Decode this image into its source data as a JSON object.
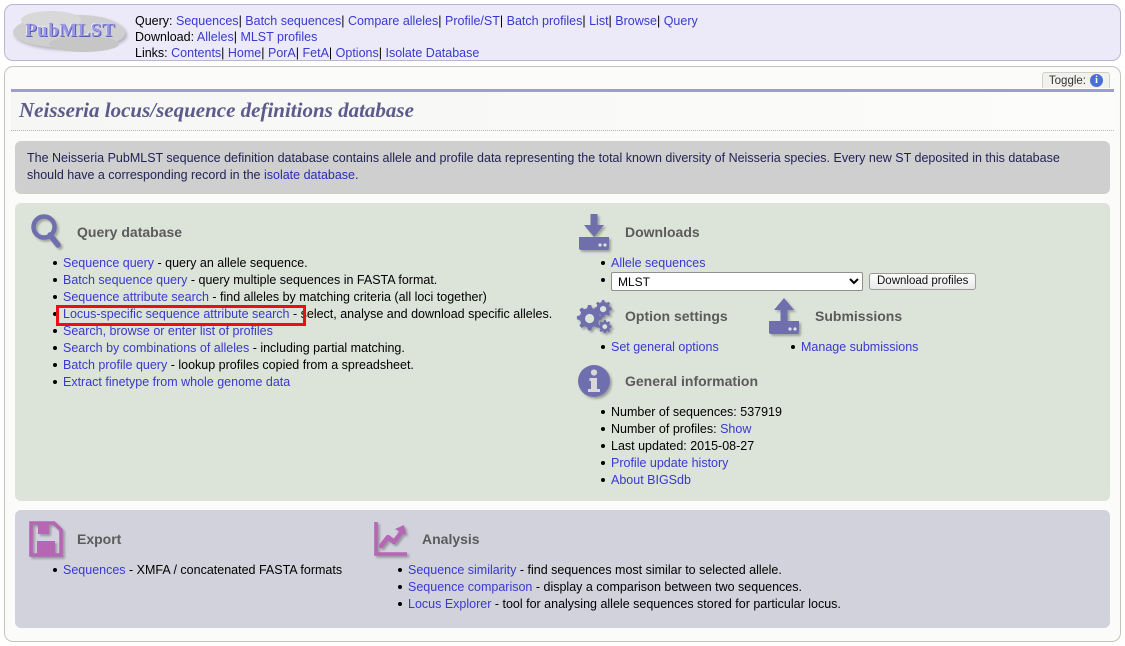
{
  "header": {
    "logo_text": "PubMLST",
    "rows": [
      {
        "label": "Query:",
        "links": [
          "Sequences",
          "Batch sequences",
          "Compare alleles",
          "Profile/ST",
          "Batch profiles",
          "List",
          "Browse",
          "Query"
        ]
      },
      {
        "label": "Download:",
        "links": [
          "Alleles",
          "MLST profiles"
        ]
      },
      {
        "label": "Links:",
        "links": [
          "Contents",
          "Home",
          "PorA",
          "FetA",
          "Options",
          "Isolate Database"
        ]
      }
    ],
    "separator": "|"
  },
  "toggle": {
    "label": "Toggle:",
    "icon": "info-icon"
  },
  "page_title": "Neisseria locus/sequence definitions database",
  "intro": {
    "text_before": "The Neisseria PubMLST sequence definition database contains allele and profile data representing the total known diversity of Neisseria species. Every new ST deposited in this database should have a corresponding record in the ",
    "link": "isolate database",
    "text_after": "."
  },
  "sections": {
    "query_database": {
      "title": "Query database",
      "icon": "magnifier-icon",
      "items": [
        {
          "link": "Sequence query",
          "desc": " - query an allele sequence."
        },
        {
          "link": "Batch sequence query",
          "desc": " - query multiple sequences in FASTA format."
        },
        {
          "link": "Sequence attribute search",
          "desc": " - find alleles by matching criteria (all loci together)"
        },
        {
          "link": "Locus-specific sequence attribute search",
          "desc": " - select, analyse and download specific alleles."
        },
        {
          "link": "Search, browse or enter list of profiles",
          "desc": ""
        },
        {
          "link": "Search by combinations of alleles",
          "desc": " - including partial matching."
        },
        {
          "link": "Batch profile query",
          "desc": " - lookup profiles copied from a spreadsheet."
        },
        {
          "link": "Extract finetype from whole genome data",
          "desc": ""
        }
      ],
      "highlighted_item_index": 4,
      "highlight_color": "#e81010"
    },
    "downloads": {
      "title": "Downloads",
      "icon": "download-icon",
      "items": [
        {
          "link": "Allele sequences",
          "desc": ""
        }
      ],
      "select_value": "MLST",
      "select_options": [
        "MLST"
      ],
      "button_label": "Download profiles"
    },
    "option_settings": {
      "title": "Option settings",
      "icon": "gears-icon",
      "items": [
        {
          "link": "Set general options",
          "desc": ""
        }
      ]
    },
    "submissions": {
      "title": "Submissions",
      "icon": "upload-icon",
      "items": [
        {
          "link": "Manage submissions",
          "desc": ""
        }
      ]
    },
    "general_information": {
      "title": "General information",
      "icon": "info-circle-icon",
      "items": [
        {
          "plain": "Number of sequences: 537919"
        },
        {
          "plain_before": "Number of profiles: ",
          "link": "Show"
        },
        {
          "plain": "Last updated: 2015-08-27"
        },
        {
          "link": "Profile update history"
        },
        {
          "link": "About BIGSdb"
        }
      ]
    },
    "export": {
      "title": "Export",
      "icon": "floppy-disk-icon",
      "items": [
        {
          "link": "Sequences",
          "desc": " - XMFA / concatenated FASTA formats"
        }
      ]
    },
    "analysis": {
      "title": "Analysis",
      "icon": "chart-line-icon",
      "items": [
        {
          "link": "Sequence similarity",
          "desc": " - find sequences most similar to selected allele."
        },
        {
          "link": "Sequence comparison",
          "desc": " - display a comparison between two sequences."
        },
        {
          "link": "Locus Explorer",
          "desc": " - tool for analysing allele sequences stored for particular locus."
        }
      ]
    }
  },
  "colors": {
    "link": "#3939cf",
    "icon_purple": "#6f6fae",
    "icon_magenta": "#b566b5",
    "green_panel": "#dce3d8",
    "grey_panel": "#d2d2dd",
    "header_panel": "#eceaf8",
    "title_purple": "#5b5b8c"
  }
}
